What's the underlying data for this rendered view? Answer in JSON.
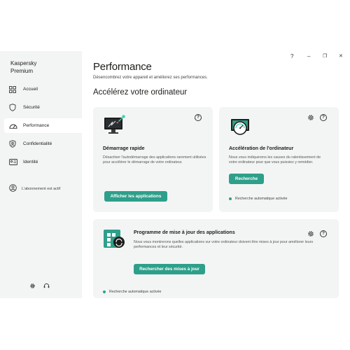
{
  "app": {
    "brand_line1": "Kaspersky",
    "brand_line2": "Premium"
  },
  "window_controls": {
    "help": "?",
    "minimize": "–",
    "restore": "❐",
    "close": "✕"
  },
  "sidebar": {
    "items": [
      {
        "label": "Accueil",
        "icon": "home-grid-icon"
      },
      {
        "label": "Sécurité",
        "icon": "shield-icon"
      },
      {
        "label": "Performance",
        "icon": "speedometer-icon",
        "active": true
      },
      {
        "label": "Confidentialité",
        "icon": "privacy-shield-icon"
      },
      {
        "label": "Identité",
        "icon": "id-card-icon"
      }
    ],
    "subscription_status": "L'abonnement est actif"
  },
  "main": {
    "title": "Performance",
    "subtitle": "Désencombrez votre appareil et améliorez ses performances.",
    "section_title": "Accélérez votre ordinateur",
    "cards": {
      "quick_start": {
        "title": "Démarrage rapide",
        "description": "Désactiver l'autodémarrage des applications rarement utilisées pour accélérer le démarrage de votre ordinateur.",
        "button": "Afficher les applications"
      },
      "acceleration": {
        "title": "Accélération de l'ordinateur",
        "description": "Nous vous indiquerons les causes du ralentissement de votre ordinateur pour que vous puissiez y remédier.",
        "button": "Recherche",
        "status": "Recherche automatique activée"
      },
      "app_updates": {
        "title": "Programme de mise à jour des applications",
        "description": "Nous vous montrerons quelles applications sur votre ordinateur doivent être mises à jour pour améliorer leurs performances et leur sécurité.",
        "button": "Rechercher des mises à jour",
        "status": "Recherche automatique activée"
      }
    }
  },
  "colors": {
    "accent": "#2d9f8a",
    "sidebar_bg": "#f3f4f4",
    "card_bg": "#f3f5f5"
  }
}
